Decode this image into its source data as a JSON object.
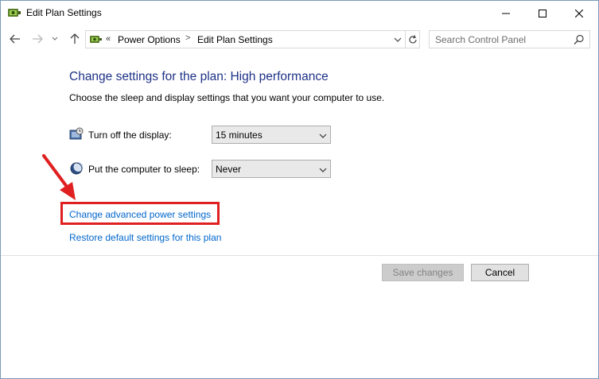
{
  "window": {
    "title": "Edit Plan Settings"
  },
  "icons": {
    "app": "power-options-icon",
    "minimize": "minimize-icon",
    "maximize": "maximize-icon",
    "close": "close-icon",
    "back": "back-arrow-icon",
    "forward": "forward-arrow-icon",
    "recent": "chevron-down-icon",
    "up": "up-arrow-icon",
    "refresh": "refresh-icon",
    "search": "search-icon",
    "display": "monitor-clock-icon",
    "sleep": "moon-icon"
  },
  "address": {
    "overflow": "«",
    "breadcrumbs": [
      "Power Options",
      "Edit Plan Settings"
    ],
    "separator": ">"
  },
  "search": {
    "placeholder": "Search Control Panel"
  },
  "main": {
    "title": "Change settings for the plan: High performance",
    "subtitle": "Choose the sleep and display settings that you want your computer to use.",
    "settings": [
      {
        "label": "Turn off the display:",
        "value": "15 minutes"
      },
      {
        "label": "Put the computer to sleep:",
        "value": "Never"
      }
    ],
    "links": {
      "advanced": "Change advanced power settings",
      "restore": "Restore default settings for this plan"
    }
  },
  "buttons": {
    "save": "Save changes",
    "cancel": "Cancel"
  },
  "colors": {
    "title": "#1e3287",
    "link": "#0066cc",
    "highlight": "#e02020"
  }
}
